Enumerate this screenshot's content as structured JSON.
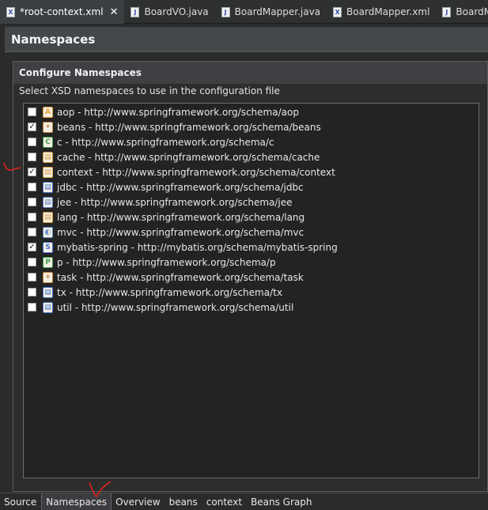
{
  "tabs": [
    {
      "label": "*root-context.xml",
      "icon": "xml-file-icon",
      "active": true,
      "closable": true
    },
    {
      "label": "BoardVO.java",
      "icon": "java-file-icon"
    },
    {
      "label": "BoardMapper.java",
      "icon": "java-file-icon"
    },
    {
      "label": "BoardMapper.xml",
      "icon": "xml-file-icon"
    },
    {
      "label": "BoardM",
      "icon": "java-file-icon"
    }
  ],
  "form": {
    "title": "Namespaces"
  },
  "section": {
    "title": "Configure Namespaces",
    "description": "Select XSD namespaces to use in the configuration file"
  },
  "namespaces": [
    {
      "label": "aop - http://www.springframework.org/schema/aop",
      "checked": false,
      "icon": "aop-icon",
      "color": "#e8a33a",
      "glyph": "A"
    },
    {
      "label": "beans - http://www.springframework.org/schema/beans",
      "checked": true,
      "icon": "beans-icon",
      "color": "#c8853a",
      "glyph": "•"
    },
    {
      "label": "c - http://www.springframework.org/schema/c",
      "checked": false,
      "icon": "c-icon",
      "color": "#3f9f4a",
      "glyph": "C"
    },
    {
      "label": "cache - http://www.springframework.org/schema/cache",
      "checked": false,
      "icon": "cache-icon",
      "color": "#d89a3a",
      "glyph": "▤"
    },
    {
      "label": "context - http://www.springframework.org/schema/context",
      "checked": true,
      "icon": "context-icon",
      "color": "#d4a34a",
      "glyph": "▤"
    },
    {
      "label": "jdbc - http://www.springframework.org/schema/jdbc",
      "checked": false,
      "icon": "jdbc-icon",
      "color": "#4a74c8",
      "glyph": "▤"
    },
    {
      "label": "jee - http://www.springframework.org/schema/jee",
      "checked": false,
      "icon": "jee-icon",
      "color": "#5a7cc8",
      "glyph": "▤"
    },
    {
      "label": "lang - http://www.springframework.org/schema/lang",
      "checked": false,
      "icon": "lang-icon",
      "color": "#d89a3a",
      "glyph": "▤"
    },
    {
      "label": "mvc - http://www.springframework.org/schema/mvc",
      "checked": false,
      "icon": "mvc-icon",
      "color": "#5a8ccf",
      "glyph": "◐"
    },
    {
      "label": "mybatis-spring - http://mybatis.org/schema/mybatis-spring",
      "checked": true,
      "icon": "mybatis-icon",
      "color": "#3f6fd0",
      "glyph": "S"
    },
    {
      "label": "p - http://www.springframework.org/schema/p",
      "checked": false,
      "icon": "p-icon",
      "color": "#3f9f4a",
      "glyph": "P"
    },
    {
      "label": "task - http://www.springframework.org/schema/task",
      "checked": false,
      "icon": "task-icon",
      "color": "#c8853a",
      "glyph": "✶"
    },
    {
      "label": "tx - http://www.springframework.org/schema/tx",
      "checked": false,
      "icon": "tx-icon",
      "color": "#4a74c8",
      "glyph": "▤"
    },
    {
      "label": "util - http://www.springframework.org/schema/util",
      "checked": false,
      "icon": "util-icon",
      "color": "#4a74c8",
      "glyph": "▤"
    }
  ],
  "bottom_tabs": [
    {
      "label": "Source",
      "active": false
    },
    {
      "label": "Namespaces",
      "active": true
    },
    {
      "label": "Overview",
      "active": false
    },
    {
      "label": "beans",
      "active": false
    },
    {
      "label": "context",
      "active": false
    },
    {
      "label": "Beans Graph",
      "active": false
    }
  ],
  "annotation_color": "#e02020"
}
